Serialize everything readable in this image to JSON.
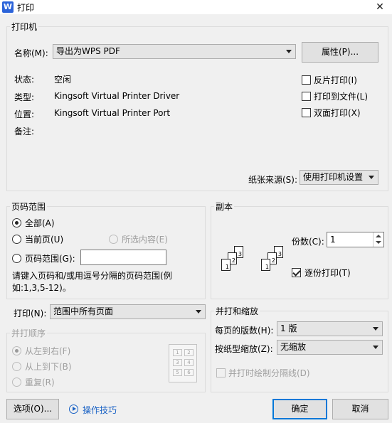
{
  "window": {
    "title": "打印",
    "close_icon": "✕"
  },
  "printer": {
    "group_title": "打印机",
    "name_label": "名称(M):",
    "name_value": "导出为WPS PDF",
    "properties_button": "属性(P)...",
    "status_label": "状态:",
    "status_value": "空闲",
    "type_label": "类型:",
    "type_value": "Kingsoft Virtual Printer Driver",
    "location_label": "位置:",
    "location_value": "Kingsoft Virtual Printer Port",
    "comment_label": "备注:",
    "reverse_print": "反片打印(I)",
    "print_to_file": "打印到文件(L)",
    "duplex_print": "双面打印(X)",
    "paper_source_label": "纸张来源(S):",
    "paper_source_value": "使用打印机设置"
  },
  "page_range": {
    "group_title": "页码范围",
    "all": "全部(A)",
    "current_page": "当前页(U)",
    "selection": "所选内容(E)",
    "pages": "页码范围(G):",
    "pages_value": "",
    "hint": "请键入页码和/或用逗号分隔的页码范围(例如:1,3,5-12)。"
  },
  "copies": {
    "group_title": "副本",
    "count_label": "份数(C):",
    "count_value": "1",
    "collate": "逐份打印(T)",
    "stack_pages": [
      "1",
      "2",
      "3"
    ]
  },
  "print_what": {
    "label": "打印(N):",
    "value": "范围中所有页面"
  },
  "order": {
    "group_title": "并打顺序",
    "left_to_right": "从左到右(F)",
    "top_to_bottom": "从上到下(B)",
    "repeat": "重复(R)",
    "preview_cells": [
      "1",
      "2",
      "3",
      "4",
      "5",
      "6"
    ]
  },
  "zoom": {
    "group_title": "并打和缩放",
    "pages_per_sheet_label": "每页的版数(H):",
    "pages_per_sheet_value": "1 版",
    "scale_label": "按纸型缩放(Z):",
    "scale_value": "无缩放",
    "draw_lines": "并打时绘制分隔线(D)"
  },
  "footer": {
    "options_button": "选项(O)...",
    "tips_link": "操作技巧",
    "ok_button": "确定",
    "cancel_button": "取消"
  },
  "colors": {
    "accent": "#0078d7",
    "link": "#1a62c5",
    "app_icon": "#2b63d9"
  }
}
